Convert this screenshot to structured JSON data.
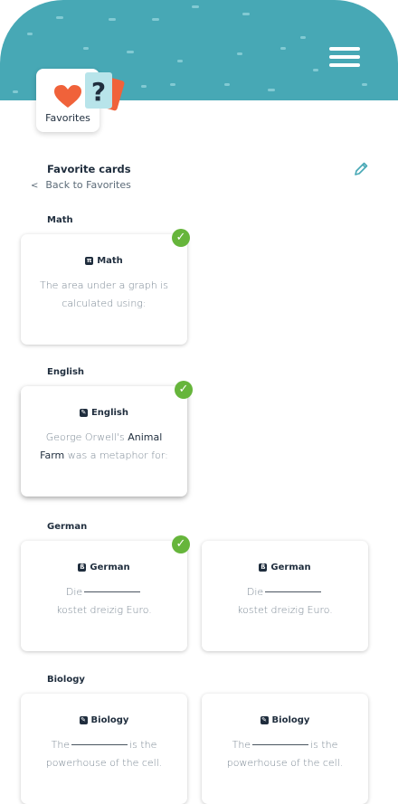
{
  "app": {
    "header_color": "#47a8b5",
    "accent_green": "#66b53b",
    "badge_label": "Favorites",
    "badge_icons": [
      "heart-icon",
      "question-card-icon"
    ]
  },
  "page": {
    "title": "Favorite cards",
    "back_label": "Back to Favorites",
    "edit_icon": "pencil-icon",
    "menu_icon": "hamburger-icon"
  },
  "sections": [
    {
      "name": "Math",
      "cards": [
        {
          "subject": "Math",
          "icon_glyph": "π",
          "question": "The area under a graph is calculated using:",
          "checked": true
        }
      ]
    },
    {
      "name": "English",
      "cards": [
        {
          "subject": "English",
          "icon_glyph": "✎",
          "question_pre": "George Orwell's ",
          "question_bold": "Animal Farm",
          "question_post": " was a metaphor for:",
          "checked": true
        }
      ]
    },
    {
      "name": "German",
      "cards": [
        {
          "subject": "German",
          "icon_glyph": "ß",
          "question_pre": "Die",
          "question_post": "kostet dreizig Euro.",
          "checked": true
        },
        {
          "subject": "German",
          "icon_glyph": "ß",
          "question_pre": "Die",
          "question_post": "kostet dreizig Euro.",
          "checked": false
        }
      ]
    },
    {
      "name": "Biology",
      "cards": [
        {
          "subject": "Biology",
          "icon_glyph": "✎",
          "question_pre": "The",
          "question_mid": "is the",
          "question_post": "powerhouse of the cell.",
          "checked": false
        },
        {
          "subject": "Biology",
          "icon_glyph": "✎",
          "question_pre": "The",
          "question_mid": "is the",
          "question_post": "powerhouse of the cell.",
          "checked": false
        }
      ]
    }
  ]
}
